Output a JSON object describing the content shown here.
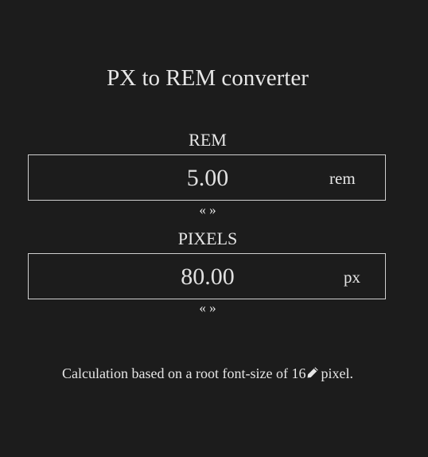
{
  "title": "PX to REM converter",
  "rem": {
    "label": "REM",
    "value": "5.00",
    "unit": "rem"
  },
  "pixels": {
    "label": "PIXELS",
    "value": "80.00",
    "unit": "px"
  },
  "swap_label": "« »",
  "footer": {
    "prefix": "Calculation based on a root font-size of",
    "root_size": "16",
    "suffix": "pixel."
  },
  "icons": {
    "edit": "pencil-icon"
  },
  "colors": {
    "background": "#1c1c1c",
    "text": "#e6e6e6",
    "border": "#cfcfcf"
  }
}
